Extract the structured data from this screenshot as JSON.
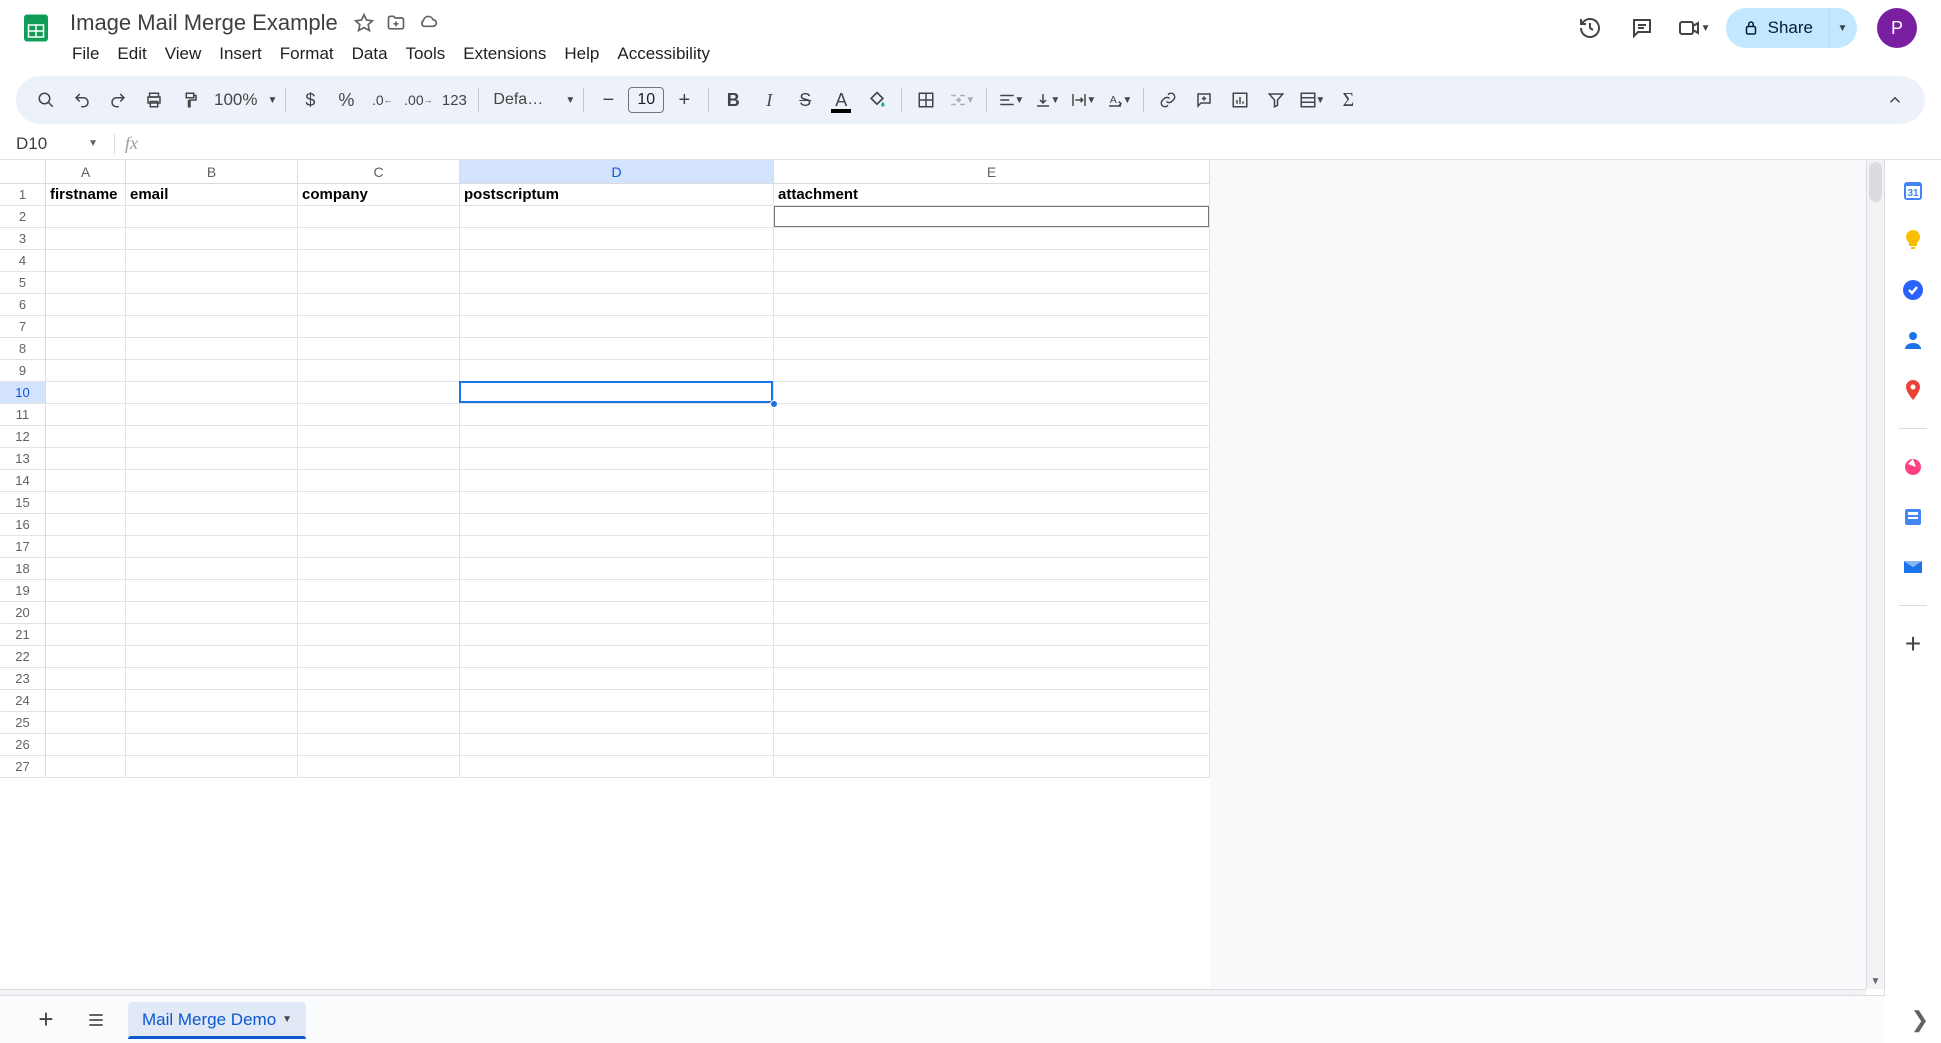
{
  "doc": {
    "title": "Image Mail Merge Example"
  },
  "menus": [
    "File",
    "Edit",
    "View",
    "Insert",
    "Format",
    "Data",
    "Tools",
    "Extensions",
    "Help",
    "Accessibility"
  ],
  "share": {
    "label": "Share"
  },
  "avatar": {
    "initial": "P"
  },
  "toolbar": {
    "zoom": "100%",
    "format_123": "123",
    "font_name": "Defaul...",
    "font_size": "10"
  },
  "namebox": {
    "value": "D10"
  },
  "formula": {
    "value": ""
  },
  "columns": [
    {
      "letter": "A",
      "width_class": "cw-A",
      "selected": false
    },
    {
      "letter": "B",
      "width_class": "cw-B",
      "selected": false
    },
    {
      "letter": "C",
      "width_class": "cw-C",
      "selected": false
    },
    {
      "letter": "D",
      "width_class": "cw-D",
      "selected": true
    },
    {
      "letter": "E",
      "width_class": "cw-E",
      "selected": false
    }
  ],
  "row_count": 27,
  "selected_row": 10,
  "header_row": {
    "A": "firstname",
    "B": "email",
    "C": "company",
    "D": "postscriptum",
    "E": "attachment"
  },
  "active_cell": {
    "col": "D",
    "row": 10
  },
  "hover_cell": {
    "col": "E",
    "row": 2
  },
  "sheet_tab": {
    "name": "Mail Merge Demo"
  },
  "side_icons": [
    "calendar",
    "keep",
    "tasks",
    "contacts",
    "maps",
    "meteor",
    "docs",
    "mail"
  ]
}
